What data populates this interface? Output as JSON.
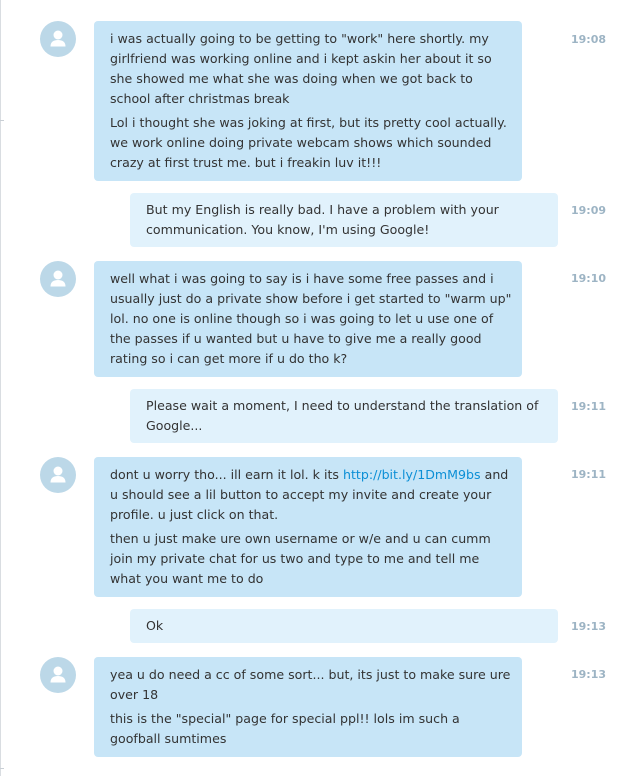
{
  "messages": [
    {
      "time": "19:08",
      "paragraphs": [
        "i was actually going to be getting to \"work\" here shortly. my girlfriend was working online and i kept askin her about it so she showed me what she was doing when we got back to school after christmas break",
        "Lol i thought she was joking at first, but its pretty cool actually. we work online doing private webcam shows which sounded crazy at first trust me. but i freakin luv it!!!"
      ]
    },
    {
      "time": "19:09",
      "paragraphs": [
        "But my English is really bad. I have a problem with your communication. You know, I'm using Google!"
      ]
    },
    {
      "time": "19:10",
      "paragraphs": [
        "well what i was going to say is i have some free passes and i usually just do a private show before i get started to \"warm up\" lol. no one is online though so i was going to let u use one of the passes if u wanted but u have to give me a really good rating so i can get more if u do tho k?"
      ]
    },
    {
      "time": "19:11",
      "paragraphs": [
        "Please wait a moment, I need to understand the translation of Google..."
      ]
    },
    {
      "time": "19:11",
      "text_before_link": "dont u worry tho... ill earn it lol. k its ",
      "link": "http://bit.ly/1DmM9bs",
      "text_after_link": " and u should see a lil button to accept my invite and create your profile. u just click on that.",
      "paragraphs": [
        "then u just make ure own username or w/e and u can cumm join my private chat for us two and type to me and tell me what you want me to do"
      ]
    },
    {
      "time": "19:13",
      "paragraphs": [
        "Ok"
      ]
    },
    {
      "time": "19:13",
      "paragraphs": [
        "yea u do need a cc of some sort... but, its just to make sure ure over 18",
        "this is the \"special\" page for special ppl!! lols im such a goofball sumtimes"
      ]
    }
  ],
  "colors": {
    "incoming_bubble": "#c7e5f7",
    "outgoing_bubble": "#e1f2fc",
    "timestamp": "#9db4c4",
    "link": "#0c8fd6",
    "avatar": "#bcd8e8"
  },
  "icons": {
    "avatar": "user-silhouette-icon"
  }
}
